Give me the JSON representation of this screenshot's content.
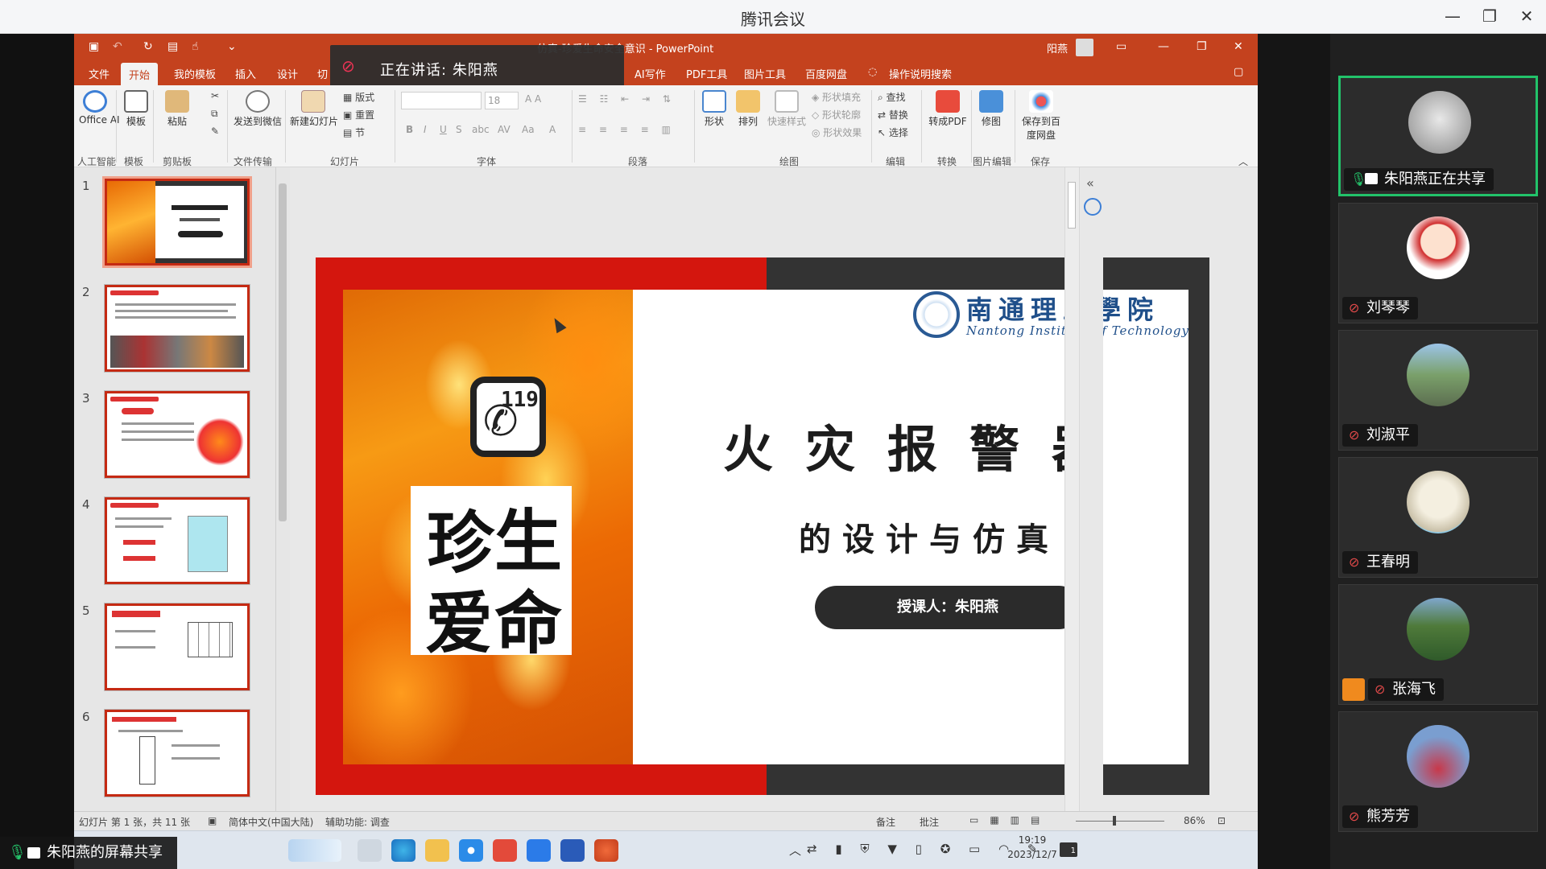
{
  "meeting": {
    "title": "腾讯会议",
    "share_label": "朱阳燕的屏幕共享"
  },
  "window": {
    "minimize": "—",
    "restore": "❐",
    "close": "✕"
  },
  "ppt": {
    "title": "仿真-珍爱生命安全意识 - PowerPoint",
    "title_prefix": "...火灾报警器设计与",
    "user": "阳燕",
    "tabs": [
      "文件",
      "开始",
      "我的模板",
      "插入",
      "设计",
      "切",
      "AI写作",
      "PDF工具",
      "图片工具",
      "百度网盘",
      "操作说明搜索"
    ],
    "active_tab": "开始",
    "speaker": {
      "label": "正在讲话:",
      "name": "朱阳燕"
    },
    "ribbon": {
      "office_ai": "Office AI",
      "templates": "模板",
      "paste": "粘贴",
      "send": "发送到微信",
      "new_slide": "新建幻灯片",
      "layout": "版式",
      "reset": "重置",
      "section": "节",
      "shape": "形状",
      "arrange": "排列",
      "quick_style": "快速样式",
      "fill": "形状填充",
      "outline": "形状轮廓",
      "effect": "形状效果",
      "find": "查找",
      "replace": "替换",
      "select": "选择",
      "to_pdf": "转成PDF",
      "edit_image": "修图",
      "save_cloud": "保存到百度网盘",
      "font_size": "18",
      "groups": [
        "人工智能",
        "模板",
        "剪贴板",
        "文件传输",
        "幻灯片",
        "字体",
        "段落",
        "绘图",
        "编辑",
        "转换",
        "图片编辑",
        "保存"
      ]
    },
    "thumb_numbers": [
      "1",
      "2",
      "3",
      "4",
      "5",
      "6"
    ],
    "status": {
      "slide_info": "幻灯片 第 1 张，共 11 张",
      "language": "简体中文(中国大陆)",
      "accessibility": "辅助功能: 调查",
      "notes": "备注",
      "comments": "批注",
      "zoom": "86%"
    }
  },
  "slide": {
    "phone_number": "119",
    "calligraphy": [
      "珍",
      "生",
      "爱",
      "命"
    ],
    "school_cn": "南通理工學院",
    "school_en": "Nantong Institute of Technology",
    "title": "火灾报警器",
    "subtitle": "的设计与仿真",
    "lecturer": "授课人：朱阳燕"
  },
  "taskbar": {
    "time": "19:19",
    "date": "2023/12/7",
    "notification": "1"
  },
  "participants": [
    {
      "name": "朱阳燕正在共享",
      "mic": "on",
      "active": true
    },
    {
      "name": "刘琴琴",
      "mic": "off"
    },
    {
      "name": "刘淑平",
      "mic": "off"
    },
    {
      "name": "王春明",
      "mic": "off"
    },
    {
      "name": "张海飞",
      "mic": "off"
    },
    {
      "name": "熊芳芳",
      "mic": "off"
    }
  ],
  "colors": {
    "ppt_accent": "#c4421e",
    "slide_red": "#d4160e",
    "active_border": "#22c36a"
  }
}
